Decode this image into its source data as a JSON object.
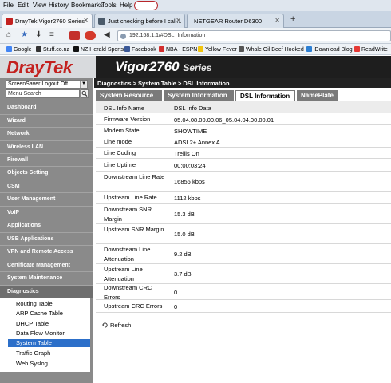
{
  "browser": {
    "menu": [
      "File",
      "Edit",
      "View",
      "History",
      "Bookmarks",
      "Tools",
      "Help"
    ],
    "tabs": [
      {
        "title": "DrayTek Vigor2760 Series",
        "active": true
      },
      {
        "title": "Just checking before I call...",
        "active": false
      },
      {
        "title": "NETGEAR Router D6300",
        "active": false
      }
    ],
    "url": "192.168.1.1/#DSL_Information",
    "bookmarks": [
      "Google",
      "Stuff.co.nz",
      "NZ Herald Sports",
      "Facebook",
      "NBA - ESPN",
      "Yellow Fever",
      "Whale Oil Beef Hooked",
      "iDownload Blog",
      "ReadWrite"
    ]
  },
  "header": {
    "logo": "DrayTek",
    "model": "Vigor2760",
    "series": "Series"
  },
  "sidebar": {
    "logout_select": "ScreenSaver Logout Off",
    "search_placeholder": "Menu Search",
    "items": [
      "Dashboard",
      "Wizard",
      "Network",
      "Wireless LAN",
      "Firewall",
      "Objects Setting",
      "CSM",
      "User Management",
      "VoIP",
      "Applications",
      "USB Applications",
      "VPN and Remote Access",
      "Certificate Management",
      "System Maintenance",
      "Diagnostics"
    ],
    "subitems": [
      "Routing Table",
      "ARP Cache Table",
      "DHCP Table",
      "Data Flow Monitor",
      "System Table",
      "Traffic Graph",
      "Web Syslog"
    ],
    "selected_subitem": "System Table"
  },
  "main": {
    "breadcrumb": "Diagnostics > System Table > DSL Information",
    "tabs": [
      "System Resource",
      "System Information",
      "DSL Information",
      "NamePlate"
    ],
    "active_tab": "DSL Information",
    "columns": [
      "DSL Info Name",
      "DSL Info Data"
    ],
    "rows": [
      {
        "name": "Firmware Version",
        "value": "05.04.08.00.00.06_05.04.04.00.00.01"
      },
      {
        "name": "Modem State",
        "value": "SHOWTIME"
      },
      {
        "name": "Line mode",
        "value": "ADSL2+ Annex A"
      },
      {
        "name": "Line Coding",
        "value": "Trellis On"
      },
      {
        "name": "Line Uptime",
        "value": "00:00:03:24"
      },
      {
        "name": "Downstream Line Rate",
        "value": "16856 kbps"
      },
      {
        "name": "Upstream Line Rate",
        "value": "1112 kbps"
      },
      {
        "name": "Downstream SNR Margin",
        "value": "15.3 dB"
      },
      {
        "name": "Upstream SNR Margin",
        "value": "15.0 dB"
      },
      {
        "name": "Downstream Line Attenuation",
        "value": "9.2 dB"
      },
      {
        "name": "Upstream Line Attenuation",
        "value": "3.7 dB"
      },
      {
        "name": "Downstream CRC Errors",
        "value": "0"
      },
      {
        "name": "Upstream CRC Errors",
        "value": "0"
      }
    ],
    "refresh_label": "Refresh"
  }
}
